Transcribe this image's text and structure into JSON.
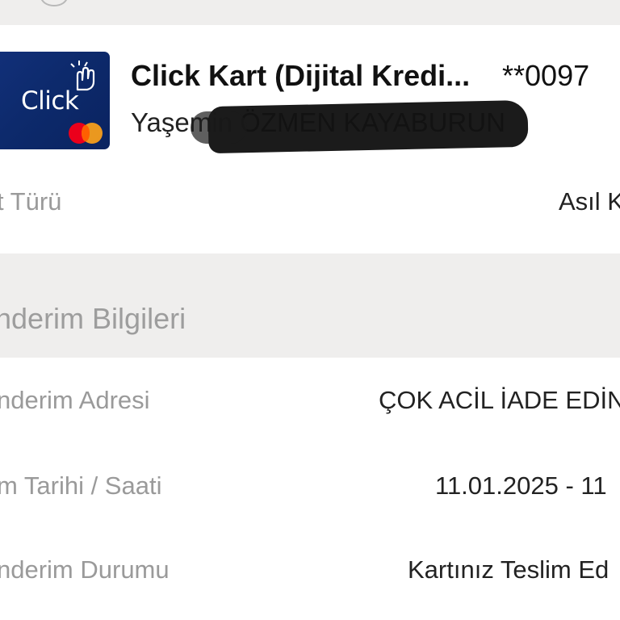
{
  "card": {
    "name": "Click Kart (Dijital Kredi...",
    "number_masked": "**0097",
    "holder": "Yaşemin ÖZMEN KAYABURUN",
    "brand_text": "Click",
    "brand_colors": {
      "card_bg": "#0d2a6c",
      "mastercard_red": "#eb001b",
      "mastercard_orange": "#f79e1b"
    }
  },
  "card_type": {
    "label": "t Türü",
    "value": "Asıl K"
  },
  "section": {
    "title": "nderim Bilgileri"
  },
  "rows": [
    {
      "label": "nderim Adresi",
      "value": "ÇOK ACİL İADE EDİN"
    },
    {
      "label": "m Tarihi / Saati",
      "value": "11.01.2025 - 11"
    },
    {
      "label": "nderim Durumu",
      "value": "Kartınız Teslim Ed"
    }
  ]
}
